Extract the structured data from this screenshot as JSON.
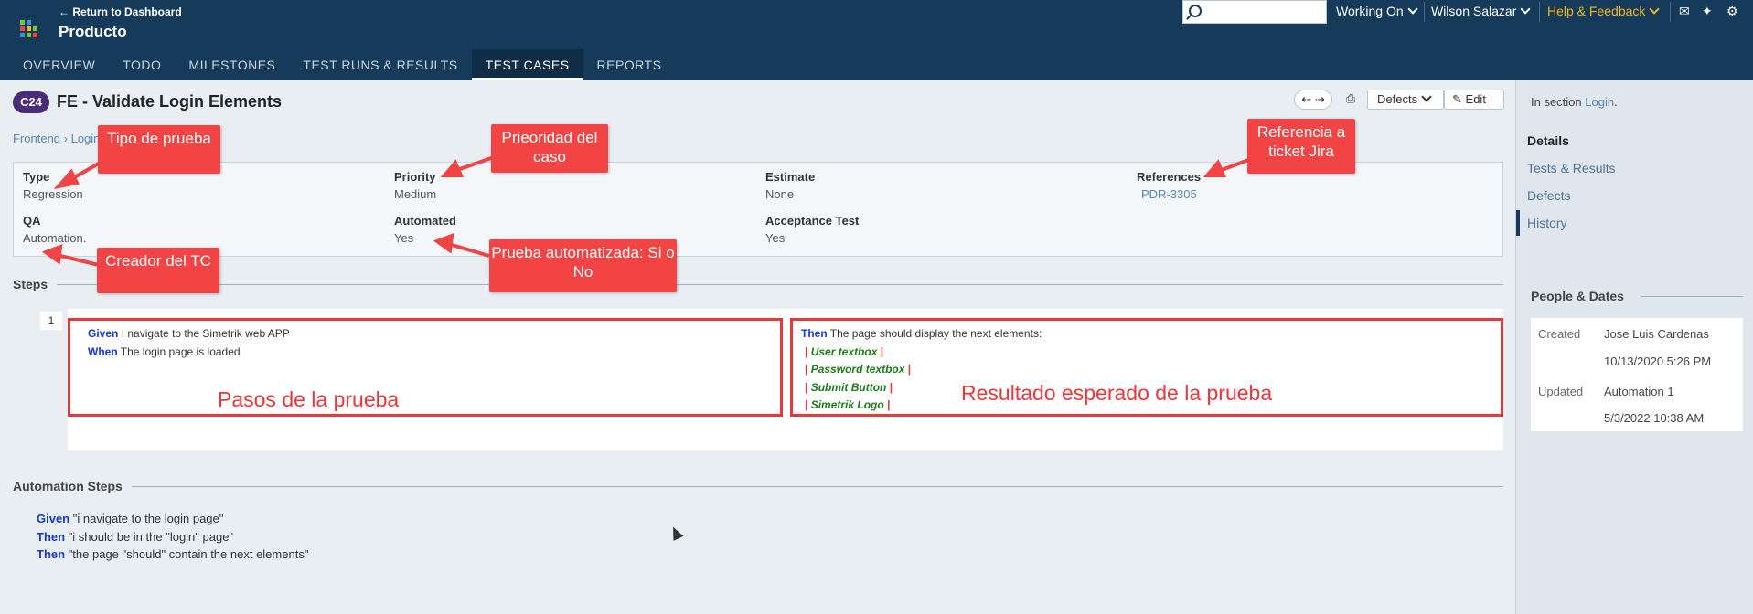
{
  "header": {
    "back_link": "← Return to Dashboard",
    "project": "Producto",
    "search_placeholder": "",
    "working_on": "Working On",
    "user": "Wilson Salazar",
    "help": "Help & Feedback",
    "help_color": "#f5b71c",
    "nav": [
      "OVERVIEW",
      "TODO",
      "MILESTONES",
      "TEST RUNS & RESULTS",
      "TEST CASES",
      "REPORTS"
    ],
    "active_nav": "TEST CASES"
  },
  "case": {
    "id": "C24",
    "title": "FE - Validate Login Elements",
    "breadcrumb": "Frontend › Login",
    "defects_button": "Defects",
    "edit_button": "Edit"
  },
  "fields": {
    "type_label": "Type",
    "type_value": "Regression",
    "priority_label": "Priority",
    "priority_value": "Medium",
    "estimate_label": "Estimate",
    "estimate_value": "None",
    "references_label": "References",
    "references_value": "PDR-3305",
    "qa_label": "QA",
    "qa_value": "Automation.",
    "automated_label": "Automated",
    "automated_value": "Yes",
    "acceptance_label": "Acceptance Test",
    "acceptance_value": "Yes"
  },
  "steps": {
    "title": "Steps",
    "number": "1",
    "given_kw": "Given",
    "given_text": "I navigate to the Simetrik web APP",
    "when_kw": "When",
    "when_text": "The login page is loaded",
    "then_kw": "Then",
    "then_text": "The page should display the next elements:",
    "elements": [
      "User textbox",
      "Password textbox",
      "Submit Button",
      "Simetrik Logo"
    ]
  },
  "automation": {
    "title": "Automation Steps",
    "lines": [
      {
        "kw": "Given",
        "text": "\"i navigate to the login page\""
      },
      {
        "kw": "Then",
        "text": "\"i should be in the \"login\" page\""
      },
      {
        "kw": "Then",
        "text": "\"the page \"should\" contain the next elements\""
      }
    ]
  },
  "annotations": {
    "tipo": "Tipo de prueba",
    "prioridad": "Prieoridad del caso",
    "referencia": "Referencia a ticket Jira",
    "creador": "Creador del TC",
    "automatizada": "Prueba automatizada: Si o No",
    "pasos": "Pasos de la prueba",
    "resultado": "Resultado esperado de la prueba",
    "callout_color": "#f24444"
  },
  "sidebar": {
    "section_prefix": "In section",
    "section_link": "Login",
    "section_suffix": ".",
    "links": [
      "Details",
      "Tests & Results",
      "Defects",
      "History"
    ],
    "people_title": "People & Dates",
    "created_label": "Created",
    "created_by": "Jose Luis Cardenas",
    "created_date": "10/13/2020 5:26 PM",
    "updated_label": "Updated",
    "updated_by": "Automation 1",
    "updated_date": "5/3/2022 10:38 AM"
  }
}
